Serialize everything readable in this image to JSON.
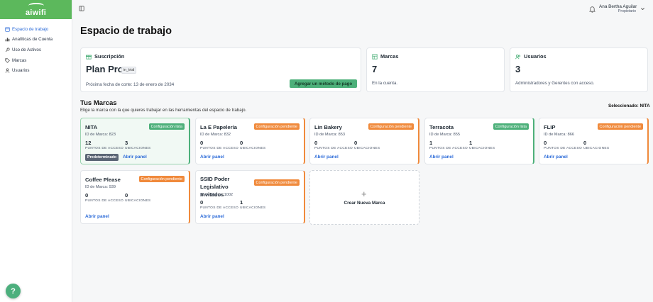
{
  "logo": {
    "text": "aiwifi"
  },
  "sidebar": {
    "items": [
      {
        "label": "Espacio de trabajo",
        "icon": "workspace-icon",
        "active": true
      },
      {
        "label": "Analíticas de Cuenta",
        "icon": "chart-icon",
        "active": false
      },
      {
        "label": "Uso de Activos",
        "icon": "key-icon",
        "active": false
      },
      {
        "label": "Marcas",
        "icon": "tag-icon",
        "active": false
      },
      {
        "label": "Usuarios",
        "icon": "user-icon",
        "active": false
      }
    ]
  },
  "topbar": {
    "user_name": "Ana Bertha Aguilar",
    "user_role": "Propietario"
  },
  "page_title": "Espacio de trabajo",
  "subscription": {
    "title": "Suscripción",
    "plan": "Plan Pro",
    "badge": "in_trial",
    "cut_date": "Próxima fecha de corte: 13 de enero de 2034",
    "add_payment": "Agregar un método de pago"
  },
  "brands_summary": {
    "title": "Marcas",
    "count": "7",
    "note": "En la cuenta."
  },
  "users_summary": {
    "title": "Usuarios",
    "count": "3",
    "note": "Administradores y Gerentes con acceso."
  },
  "brands_section": {
    "title": "Tus Marcas",
    "subtitle": "Elige la marca con la que quieres trabajar en las herramientas del espacio de trabajo.",
    "selected": "Seleccionado: NITA"
  },
  "labels": {
    "access_points": "PUNTOS DE ACCESO",
    "locations": "UBICACIONES",
    "open_panel": "Abrir panel",
    "default": "Predeterminado",
    "status_ready": "Configuración lista",
    "status_pending": "Configuración pendiente",
    "id_prefix": "ID de Marca:"
  },
  "brands": [
    {
      "name": "NITA",
      "id": "823",
      "aps": "12",
      "locs": "3",
      "status": "ready"
    },
    {
      "name": "La E Papelería",
      "id": "832",
      "aps": "0",
      "locs": "0",
      "status": "pending"
    },
    {
      "name": "Lin Bakery",
      "id": "853",
      "aps": "0",
      "locs": "0",
      "status": "pending"
    },
    {
      "name": "Terracota",
      "id": "855",
      "aps": "1",
      "locs": "1",
      "status": "ready"
    },
    {
      "name": "FLIP",
      "id": "866",
      "aps": "0",
      "locs": "0",
      "status": "pending"
    },
    {
      "name": "Coffee Please",
      "id": "939",
      "aps": "0",
      "locs": "0",
      "status": "pending"
    },
    {
      "name": "SSID Poder Legislativo Invitados",
      "id": "1002",
      "aps": "0",
      "locs": "1",
      "status": "pending"
    }
  ],
  "new_brand": {
    "label": "Crear Nueva Marca"
  },
  "help": {
    "label": "?"
  }
}
